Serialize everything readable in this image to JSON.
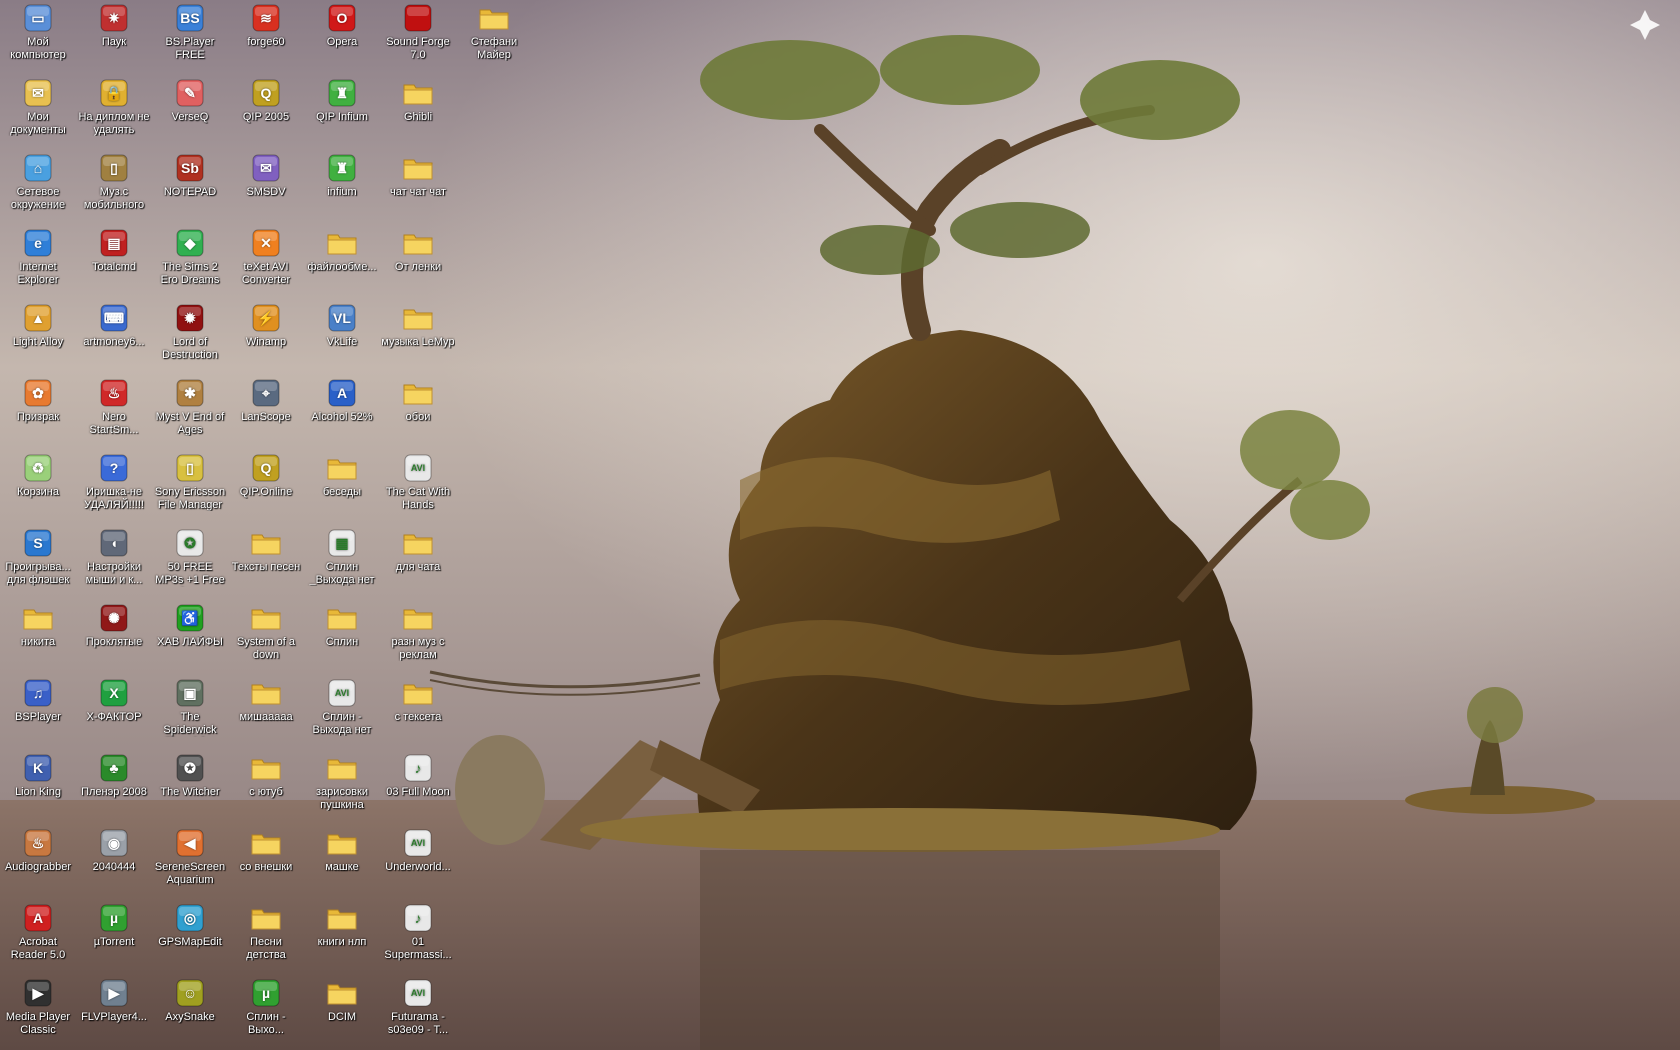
{
  "desktop": {
    "icons": [
      {
        "label": "Мой компьютер",
        "icon": "computer-icon",
        "type": "app",
        "color": "#5a8fd8",
        "glyph": "▭"
      },
      {
        "label": "Мои документы",
        "icon": "documents-folder-icon",
        "type": "app",
        "color": "#e8c050",
        "glyph": "✉"
      },
      {
        "label": "Сетевое окружение",
        "icon": "network-icon",
        "type": "app",
        "color": "#4aa0e0",
        "glyph": "⌂"
      },
      {
        "label": "Internet Explorer",
        "icon": "internet-explorer-icon",
        "type": "app",
        "color": "#2f7fd8",
        "glyph": "e"
      },
      {
        "label": "Light Alloy",
        "icon": "light-alloy-icon",
        "type": "app",
        "color": "#e0a030",
        "glyph": "▲"
      },
      {
        "label": "Призрак",
        "icon": "msn-butterfly-icon",
        "type": "app",
        "color": "#e87a30",
        "glyph": "✿"
      },
      {
        "label": "Корзина",
        "icon": "recycle-bin-icon",
        "type": "app",
        "color": "#9ad07a",
        "glyph": "♻"
      },
      {
        "label": "Проигрыва... для флэшек",
        "icon": "flash-player-icon",
        "type": "app",
        "color": "#2a78d0",
        "glyph": "S"
      },
      {
        "label": "никита",
        "icon": "folder-icon",
        "type": "folder"
      },
      {
        "label": "BSPlayer",
        "icon": "bsplayer-icon",
        "type": "app",
        "color": "#3a60c8",
        "glyph": "♫"
      },
      {
        "label": "Lion King",
        "icon": "lion-king-icon",
        "type": "app",
        "color": "#4060b0",
        "glyph": "K"
      },
      {
        "label": "Audiograbber",
        "icon": "audiograbber-icon",
        "type": "app",
        "color": "#c87840",
        "glyph": "♨"
      },
      {
        "label": "Acrobat Reader 5.0",
        "icon": "acrobat-reader-icon",
        "type": "app",
        "color": "#d02020",
        "glyph": "A"
      },
      {
        "label": "Media Player Classic",
        "icon": "media-player-classic-icon",
        "type": "app",
        "color": "#303030",
        "glyph": "▶"
      },
      {
        "label": "Паук",
        "icon": "spider-solitaire-icon",
        "type": "app",
        "color": "#c03030",
        "glyph": "✷"
      },
      {
        "label": "На диплом не удалять",
        "icon": "lock-icon",
        "type": "app",
        "color": "#e0b030",
        "glyph": "🔒"
      },
      {
        "label": "Муз.с мобильного",
        "icon": "mobile-phone-icon",
        "type": "app",
        "color": "#a08040",
        "glyph": "▯"
      },
      {
        "label": "Totalcmd",
        "icon": "floppy-disk-icon",
        "type": "app",
        "color": "#c02020",
        "glyph": "▤"
      },
      {
        "label": "artmoney6...",
        "icon": "artmoney-icon",
        "type": "app",
        "color": "#3a6ad0",
        "glyph": "⌨"
      },
      {
        "label": "Nero StartSm...",
        "icon": "nero-icon",
        "type": "app",
        "color": "#d02828",
        "glyph": "♨"
      },
      {
        "label": "Иришка-не УДАЛЯЙ!!!!!",
        "icon": "help-icon",
        "type": "app",
        "color": "#3a6ad8",
        "glyph": "?"
      },
      {
        "label": "Настройки мыши и к...",
        "icon": "mouse-settings-icon",
        "type": "app",
        "color": "#606878",
        "glyph": "◖"
      },
      {
        "label": "Проклятые",
        "icon": "celtic-knot-icon",
        "type": "app",
        "color": "#901818",
        "glyph": "✺"
      },
      {
        "label": "X-ФАКТОР",
        "icon": "x-factor-icon",
        "type": "app",
        "color": "#20a040",
        "glyph": "X"
      },
      {
        "label": "Пленэр 2008",
        "icon": "tree-icon",
        "type": "app",
        "color": "#2a8a2a",
        "glyph": "♣"
      },
      {
        "label": "2040444",
        "icon": "cd-icon",
        "type": "app",
        "color": "#9aa0a8",
        "glyph": "◉"
      },
      {
        "label": "µTorrent",
        "icon": "utorrent-icon",
        "type": "app",
        "color": "#30a030",
        "glyph": "µ"
      },
      {
        "label": "FLVPlayer4...",
        "icon": "flv-player-icon",
        "type": "app",
        "color": "#708090",
        "glyph": "▶"
      },
      {
        "label": "BS.Player FREE",
        "icon": "bsplayer-free-icon",
        "type": "app",
        "color": "#3a80d8",
        "glyph": "BS"
      },
      {
        "label": "VerseQ",
        "icon": "verseq-icon",
        "type": "app",
        "color": "#e06060",
        "glyph": "✎"
      },
      {
        "label": "NOTEPAD",
        "icon": "simba-notepad-icon",
        "type": "app",
        "color": "#b03020",
        "glyph": "Sb"
      },
      {
        "label": "The Sims 2 Ero Dreams",
        "icon": "sims-plumbob-icon",
        "type": "app",
        "color": "#30b050",
        "glyph": "◆"
      },
      {
        "label": "Lord of Destruction",
        "icon": "diablo-icon",
        "type": "app",
        "color": "#901010",
        "glyph": "✹"
      },
      {
        "label": "Myst V End of Ages",
        "icon": "myst-icon",
        "type": "app",
        "color": "#b08040",
        "glyph": "✱"
      },
      {
        "label": "Sony Ericsson File Manager",
        "icon": "sony-ericsson-icon",
        "type": "app",
        "color": "#d8c040",
        "glyph": "▯"
      },
      {
        "label": "50 FREE MP3s +1 Free Au...",
        "icon": "film-reel-icon",
        "type": "app",
        "color": "#e8e8e8",
        "glyph": "✪"
      },
      {
        "label": "ХАВ ЛАЙФЫ",
        "icon": "half-life-icon",
        "type": "app",
        "color": "#20a020",
        "glyph": "♿"
      },
      {
        "label": "The Spiderwick Chronicles",
        "icon": "spiderwick-icon",
        "type": "app",
        "color": "#607060",
        "glyph": "▣"
      },
      {
        "label": "The Witcher",
        "icon": "witcher-icon",
        "type": "app",
        "color": "#505050",
        "glyph": "✪"
      },
      {
        "label": "SereneScreen Aquarium",
        "icon": "fish-icon",
        "type": "app",
        "color": "#e07030",
        "glyph": "◀"
      },
      {
        "label": "GPSMapEdit",
        "icon": "gps-map-icon",
        "type": "app",
        "color": "#30a0d0",
        "glyph": "◎"
      },
      {
        "label": "AxySnake",
        "icon": "snake-icon",
        "type": "app",
        "color": "#a0a020",
        "glyph": "☺"
      },
      {
        "label": "forge60",
        "icon": "forge-icon",
        "type": "app",
        "color": "#d83020",
        "glyph": "≋"
      },
      {
        "label": "QIP 2005",
        "icon": "qip-icon",
        "type": "app",
        "color": "#c0a020",
        "glyph": "Q"
      },
      {
        "label": "SMSDV",
        "icon": "smsdv-icon",
        "type": "app",
        "color": "#8060c0",
        "glyph": "✉"
      },
      {
        "label": "teXet AVI Converter",
        "icon": "texet-avi-converter-icon",
        "type": "app",
        "color": "#f08020",
        "glyph": "✕"
      },
      {
        "label": "Winamp",
        "icon": "winamp-icon",
        "type": "app",
        "color": "#e09020",
        "glyph": "⚡"
      },
      {
        "label": "LanScope",
        "icon": "telescope-icon",
        "type": "app",
        "color": "#5a6a80",
        "glyph": "⌖"
      },
      {
        "label": "QIP.Online",
        "icon": "qip-online-icon",
        "type": "app",
        "color": "#c0a020",
        "glyph": "Q"
      },
      {
        "label": "Тексты песен",
        "icon": "folder-icon",
        "type": "folder"
      },
      {
        "label": "System of a down",
        "icon": "folder-icon",
        "type": "folder"
      },
      {
        "label": "мишааааа",
        "icon": "folder-icon",
        "type": "folder"
      },
      {
        "label": "с ютуб",
        "icon": "folder-icon",
        "type": "folder"
      },
      {
        "label": "со внешки",
        "icon": "folder-icon",
        "type": "folder"
      },
      {
        "label": "Песни детства",
        "icon": "folder-icon",
        "type": "folder"
      },
      {
        "label": "Сплин - Выхо...",
        "icon": "utorrent-file-icon",
        "type": "app",
        "color": "#30a030",
        "glyph": "µ"
      },
      {
        "label": "Opera",
        "icon": "opera-icon",
        "type": "app",
        "color": "#d01818",
        "glyph": "O"
      },
      {
        "label": "QIP Infium",
        "icon": "qip-infium-icon",
        "type": "app",
        "color": "#40b040",
        "glyph": "♜"
      },
      {
        "label": "infium",
        "icon": "infium-icon",
        "type": "app",
        "color": "#40b040",
        "glyph": "♜"
      },
      {
        "label": "файлообме...",
        "icon": "folder-icon",
        "type": "folder"
      },
      {
        "label": "VkLife",
        "icon": "vklife-icon",
        "type": "app",
        "color": "#4a80c8",
        "glyph": "VL"
      },
      {
        "label": "Alcohol 52%",
        "icon": "alcohol-icon",
        "type": "app",
        "color": "#2a60c8",
        "glyph": "A"
      },
      {
        "label": "беседы",
        "icon": "folder-icon",
        "type": "folder"
      },
      {
        "label": "Сплин _Выхода нет",
        "icon": "image-file-icon",
        "type": "app",
        "color": "#e8e8e8",
        "glyph": "▦"
      },
      {
        "label": "Сплин",
        "icon": "folder-icon",
        "type": "folder"
      },
      {
        "label": "Сплин - Выхода нет",
        "icon": "avi-file-icon",
        "type": "app",
        "color": "#e8e8e8",
        "glyph": "AVI"
      },
      {
        "label": "зарисовки пушкина",
        "icon": "folder-icon",
        "type": "folder"
      },
      {
        "label": "машке",
        "icon": "folder-icon",
        "type": "folder"
      },
      {
        "label": "книги нлп",
        "icon": "folder-icon",
        "type": "folder"
      },
      {
        "label": "DCIM",
        "icon": "folder-icon",
        "type": "folder"
      },
      {
        "label": "Sound Forge 7.0",
        "icon": "sound-forge-icon",
        "type": "app",
        "color": "#c01010",
        "glyph": ""
      },
      {
        "label": "Ghibli",
        "icon": "folder-icon",
        "type": "folder"
      },
      {
        "label": "чат чат чат",
        "icon": "folder-icon",
        "type": "folder"
      },
      {
        "label": "От ленки",
        "icon": "folder-icon",
        "type": "folder"
      },
      {
        "label": "музыка LeMyp",
        "icon": "folder-icon",
        "type": "folder"
      },
      {
        "label": "обои",
        "icon": "folder-icon",
        "type": "folder"
      },
      {
        "label": "The Cat With Hands",
        "icon": "avi-file-icon",
        "type": "app",
        "color": "#e8e8e8",
        "glyph": "AVI"
      },
      {
        "label": "для чата",
        "icon": "folder-icon",
        "type": "folder"
      },
      {
        "label": "разн муз с реклам",
        "icon": "folder-icon",
        "type": "folder"
      },
      {
        "label": "с тексета",
        "icon": "folder-icon",
        "type": "folder"
      },
      {
        "label": "03 Full Moon",
        "icon": "audio-file-icon",
        "type": "app",
        "color": "#e8e8e8",
        "glyph": "♪"
      },
      {
        "label": "Underworld...",
        "icon": "avi-file-icon",
        "type": "app",
        "color": "#e8e8e8",
        "glyph": "AVI"
      },
      {
        "label": "01 Supermassi...",
        "icon": "audio-file-icon",
        "type": "app",
        "color": "#e8e8e8",
        "glyph": "♪"
      },
      {
        "label": "Futurama - s03e09 - T...",
        "icon": "avi-file-icon",
        "type": "app",
        "color": "#e8e8e8",
        "glyph": "AVI"
      },
      {
        "label": "Стефани Майер",
        "icon": "folder-icon",
        "type": "folder"
      }
    ]
  }
}
